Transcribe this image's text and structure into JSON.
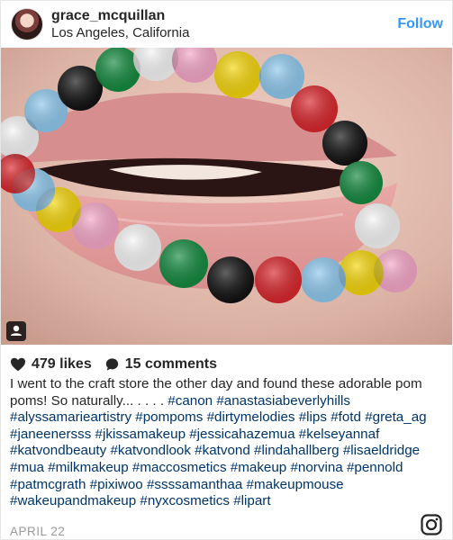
{
  "header": {
    "username": "grace_mcquillan",
    "location": "Los Angeles, California",
    "follow_label": "Follow"
  },
  "stats": {
    "likes": "479 likes",
    "comments": "15 comments"
  },
  "caption": {
    "text": "I went to the craft store the other day and found these adorable pom poms! So naturally... . . . . ",
    "hashtags": "#canon #anastasiabeverlyhills #alyssamarieartistry #pompoms #dirtymelodies #lips #fotd #greta_ag #janeenersss #jkissamakeup #jessicahazemua #kelseyannaf #katvondbeauty #katvondlook #katvond #lindahallberg #lisaeldridge #mua #milkmakeup #maccosmetics #makeup #norvina #pennold #patmcgrath #pixiwoo #ssssamanthaa #makeupmouse #wakeupandmakeup #nyxcosmetics #lipart"
  },
  "date": "APRIL 22",
  "colors": {
    "follow": "#3897f0",
    "hashtag": "#003569",
    "date": "#999999",
    "pom_red": "#d9262c",
    "pom_green": "#148a3f",
    "pom_yellow": "#f5d60a",
    "pom_blue": "#8fc9ee",
    "pom_pink": "#f6a7c8",
    "pom_black": "#111111",
    "pom_white": "#f7f7f7"
  },
  "icons": {
    "heart": "heart-icon",
    "comment": "comment-icon",
    "tag": "user-tag-icon",
    "instagram": "instagram-logo-icon"
  }
}
